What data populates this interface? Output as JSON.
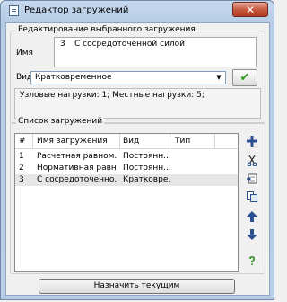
{
  "window": {
    "title": "Редактор загружений",
    "close": "✕"
  },
  "edit_group": {
    "title": "Редактирование выбранного загружения",
    "name_label": "Имя",
    "name_number": "3",
    "name_value": "С сосредоточенной силой",
    "type_label": "Вид",
    "type_value": "Кратковременное",
    "stats_text": "Узловые нагрузки: 1;  Местные нагрузки: 5;"
  },
  "list_group": {
    "title": "Список загружений",
    "columns": [
      "#",
      "Имя загружения",
      "Вид",
      "Тип"
    ],
    "rows": [
      {
        "num": "1",
        "name": "Расчетная равном...",
        "kind": "Постоянн...",
        "type": ""
      },
      {
        "num": "2",
        "name": "Нормативная равн...",
        "kind": "Постоянн...",
        "type": ""
      },
      {
        "num": "3",
        "name": "С сосредоточенно...",
        "kind": "Кратковре...",
        "type": ""
      }
    ],
    "selected_row": 2,
    "toolbar_icons": [
      "add-icon",
      "cut-icon",
      "insert-icon",
      "copy-icon",
      "arrow-up-icon",
      "arrow-down-icon",
      "help-icon"
    ]
  },
  "assign_button": "Назначить текущим",
  "colors": {
    "titlebar": "#b9cfe7",
    "close": "#c75a40",
    "check": "#2f9a20",
    "selection": "#e6e6e6"
  }
}
